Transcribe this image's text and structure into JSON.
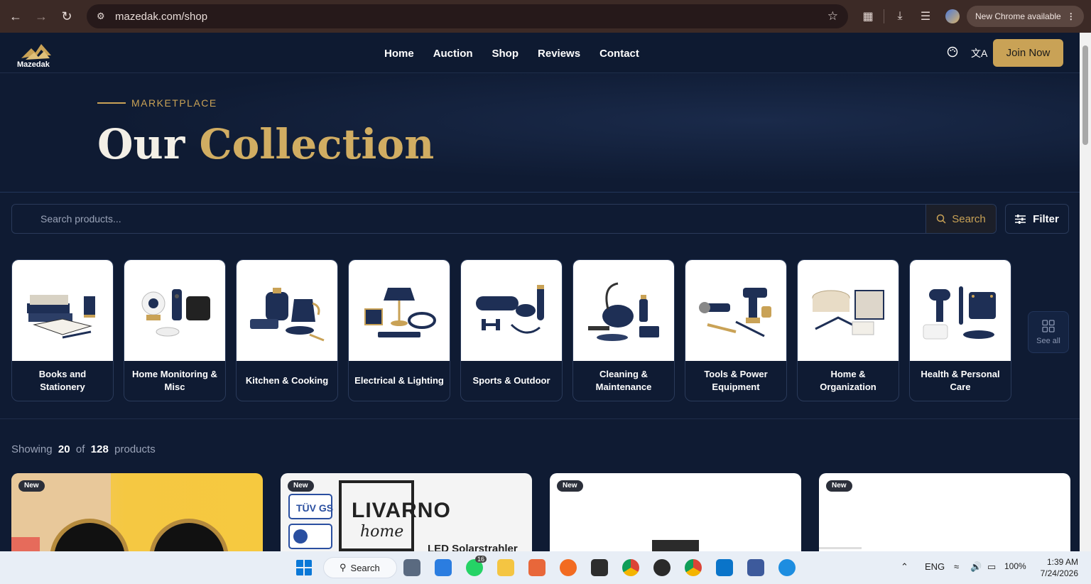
{
  "browser": {
    "url": "mazedak.com/shop",
    "update_label": "New Chrome available"
  },
  "header": {
    "logo_text": "Mazedak",
    "nav": [
      "Home",
      "Auction",
      "Shop",
      "Reviews",
      "Contact"
    ],
    "join_label": "Join Now"
  },
  "hero": {
    "eyebrow": "MARKETPLACE",
    "title_part1": "Our",
    "title_part2": "Collection"
  },
  "search": {
    "placeholder": "Search products...",
    "button_label": "Search",
    "filter_label": "Filter"
  },
  "categories": [
    {
      "label": "Books and Stationery",
      "icon": "books-icon"
    },
    {
      "label": "Home Monitoring & Misc",
      "icon": "camera-icon"
    },
    {
      "label": "Kitchen & Cooking",
      "icon": "kettle-icon"
    },
    {
      "label": "Electrical & Lighting",
      "icon": "lamp-icon"
    },
    {
      "label": "Sports & Outdoor",
      "icon": "dumbbell-icon"
    },
    {
      "label": "Cleaning & Maintenance",
      "icon": "vacuum-icon"
    },
    {
      "label": "Tools & Power Equipment",
      "icon": "drill-icon"
    },
    {
      "label": "Home & Organization",
      "icon": "basket-icon"
    },
    {
      "label": "Health & Personal Care",
      "icon": "hairdryer-icon"
    }
  ],
  "see_all_label": "See all",
  "results": {
    "prefix": "Showing",
    "shown": "20",
    "of": "of",
    "total": "128",
    "suffix": "products"
  },
  "products": [
    {
      "badge": "New"
    },
    {
      "badge": "New",
      "brand": "LIVARNO",
      "brand_sub": "home",
      "caption": "LED Solarstrahler"
    },
    {
      "badge": "New"
    },
    {
      "badge": "New"
    }
  ],
  "taskbar": {
    "search_label": "Search",
    "whatsapp_badge": "16",
    "lang": "ENG",
    "battery": "100%",
    "time": "1:39 AM",
    "date": "7/24/2026"
  },
  "colors": {
    "accent_gold": "#c9a256",
    "page_bg": "#0f1b33",
    "chrome_bg": "#3c2a26"
  }
}
